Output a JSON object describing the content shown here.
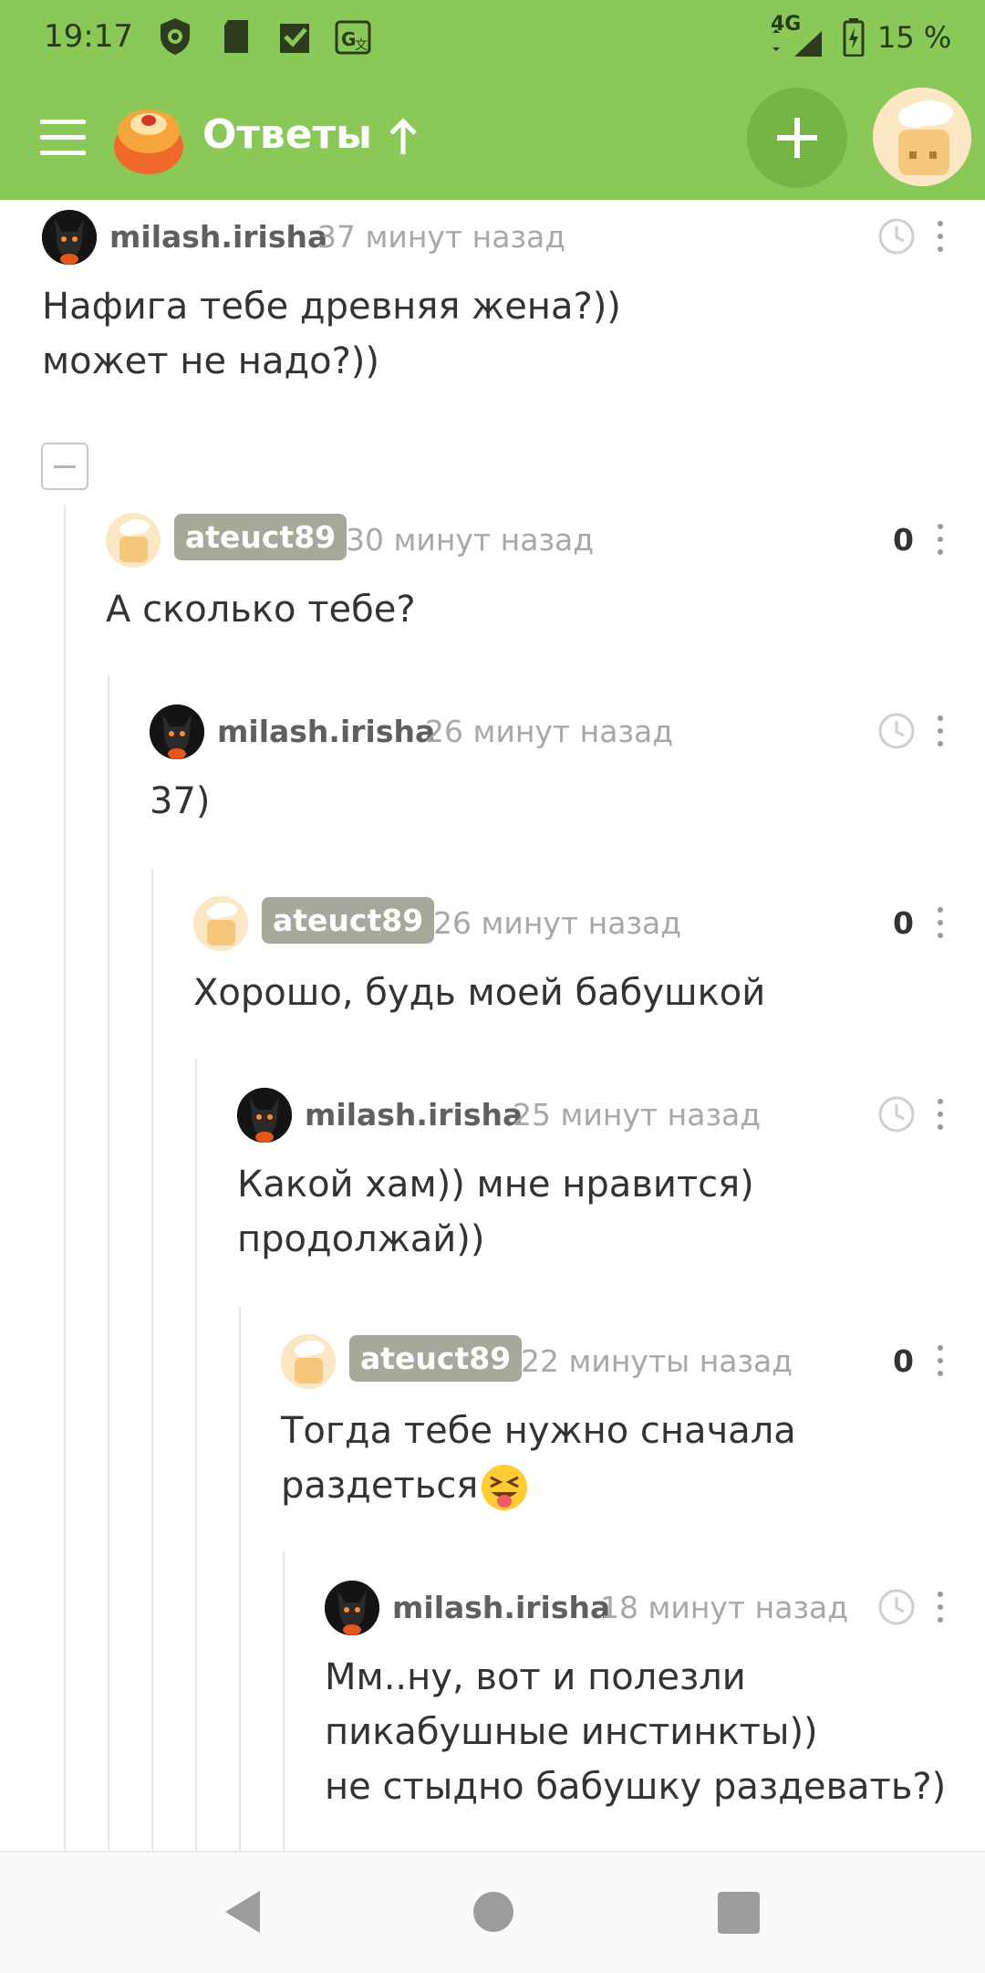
{
  "status_bar": {
    "time": "19:17",
    "network": "4G",
    "battery": "15 %",
    "icons": [
      "shield-icon",
      "sd-card-icon",
      "check-icon",
      "translate-icon",
      "signal-icon",
      "battery-icon"
    ]
  },
  "app_bar": {
    "title": "Ответы",
    "menu_icon": "hamburger-menu-icon",
    "logo_icon": "pikabu-logo-icon",
    "up_icon": "arrow-up-icon",
    "add_icon": "plus-icon",
    "avatar_icon": "user-avatar-icon"
  },
  "colors": {
    "brand_green": "#8ac858",
    "badge_gray": "#a8a89a",
    "time_gray": "#a8a8a8",
    "text": "#333333"
  },
  "comments": [
    {
      "author": "milash.irisha",
      "time": "37 минут назад",
      "text": "Нафига тебе древняя жена?))\nможет не надо?))",
      "avatar": "dark-cat-avatar",
      "action": "clock-icon"
    },
    {
      "author": "ateuct89",
      "time": "30 минут назад",
      "text": "А сколько тебе?",
      "avatar": "chef-avatar",
      "score": "0"
    },
    {
      "author": "milash.irisha",
      "time": "26 минут назад",
      "text": "37)",
      "avatar": "dark-cat-avatar",
      "action": "clock-icon"
    },
    {
      "author": "ateuct89",
      "time": "26 минут назад",
      "text": "Хорошо, будь моей бабушкой",
      "avatar": "chef-avatar",
      "score": "0"
    },
    {
      "author": "milash.irisha",
      "time": "25 минут назад",
      "text": "Какой хам)) мне нравится)\nпродолжай))",
      "avatar": "dark-cat-avatar",
      "action": "clock-icon"
    },
    {
      "author": "ateuct89",
      "time": "22 минуты назад",
      "text": "Тогда тебе нужно сначала\nраздеться",
      "emoji": "squinting-tongue-emoji",
      "avatar": "chef-avatar",
      "score": "0"
    },
    {
      "author": "milash.irisha",
      "time": "18 минут назад",
      "text": "Мм..ну, вот и полезли\nпикабушные инстинкты))\nне стыдно бабушку раздевать?)",
      "avatar": "dark-cat-avatar",
      "action": "clock-icon"
    }
  ],
  "nav_bar": {
    "icons": [
      "back-triangle-icon",
      "home-circle-icon",
      "recents-square-icon"
    ]
  }
}
